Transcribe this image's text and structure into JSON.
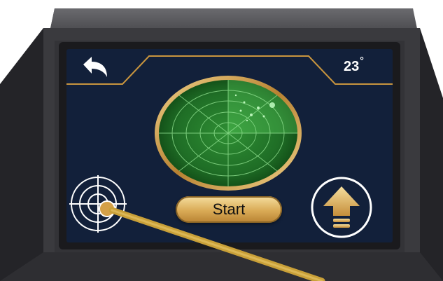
{
  "screen": {
    "temperature": "23",
    "degree_symbol": "°",
    "start_label": "Start"
  },
  "icons": {
    "back": "back-arrow-icon",
    "target": "target-icon",
    "upload": "upload-arrow-icon",
    "radar": "radar-display"
  },
  "colors": {
    "screen_bg": "#12203a",
    "accent_gold": "#c9953e",
    "radar_green": "#2e8a32",
    "text": "#ffffff"
  }
}
